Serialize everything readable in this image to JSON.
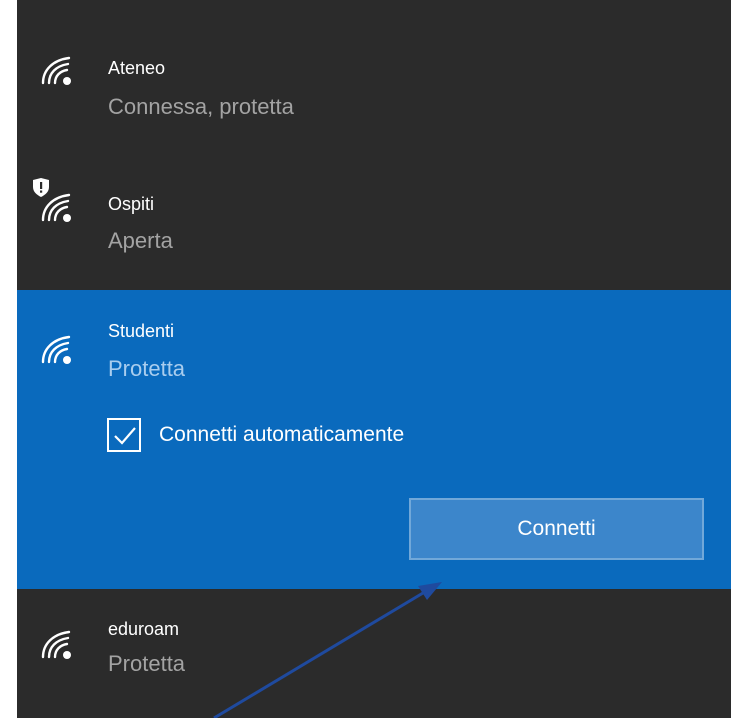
{
  "networks": [
    {
      "name": "Ateneo",
      "status": "Connessa, protetta",
      "icon": "wifi-secured-icon"
    },
    {
      "name": "Ospiti",
      "status": "Aperta",
      "icon": "wifi-open-warning-icon"
    },
    {
      "name": "Studenti",
      "status": "Protetta",
      "icon": "wifi-secured-icon",
      "auto_connect_label": "Connetti automaticamente",
      "auto_connect_checked": true,
      "connect_label": "Connetti"
    },
    {
      "name": "eduroam",
      "status": "Protetta",
      "icon": "wifi-secured-icon"
    }
  ],
  "colors": {
    "panel_bg": "#2b2b2b",
    "selected_bg": "#0a6abd",
    "button_bg": "#3c86cb",
    "annotation_arrow": "#1f4a9e"
  }
}
